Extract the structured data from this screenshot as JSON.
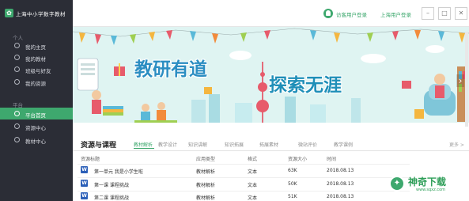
{
  "app": {
    "title": "上海中小学数字教材"
  },
  "header": {
    "guest_login": "访客用户登录",
    "shanghai_login": "上海用户登录"
  },
  "sidebar": {
    "personal_title": "个人",
    "personal_items": [
      {
        "label": "我的主页",
        "icon": "home-icon"
      },
      {
        "label": "我的教材",
        "icon": "user-icon"
      },
      {
        "label": "班级与好友",
        "icon": "friends-icon"
      },
      {
        "label": "我的资源",
        "icon": "folder-icon"
      }
    ],
    "platform_title": "平台",
    "platform_items": [
      {
        "label": "平台首页",
        "icon": "platform-home-icon",
        "active": true
      },
      {
        "label": "资源中心",
        "icon": "resource-icon"
      },
      {
        "label": "教材中心",
        "icon": "textbook-icon"
      }
    ]
  },
  "banner": {
    "left_text": "教研有道",
    "right_text": "探索无涯"
  },
  "resources": {
    "heading": "资源与课程",
    "tabs": [
      "教材解析",
      "教学设计",
      "知识讲解",
      "知识拓展",
      "拓展素材",
      "微站评价",
      "教学课例"
    ],
    "active_tab": 0,
    "more": "更多 >",
    "columns": [
      "资源标题",
      "应用类型",
      "格式",
      "资源大小",
      "时间"
    ],
    "rows": [
      [
        "第一单元 我是小学生啦",
        "教材解析",
        "文本",
        "63K",
        "2018.08.13"
      ],
      [
        "第一课 课程挑战",
        "教材解析",
        "文本",
        "50K",
        "2018.08.13"
      ],
      [
        "第二课 课程挑战",
        "教材解析",
        "文本",
        "51K",
        "2018.08.13"
      ]
    ]
  },
  "watermark": {
    "text": "神奇下载",
    "url": "www.sqxz.com"
  },
  "colors": {
    "sidebar_bg": "#2b2d36",
    "accent_green": "#3ea86e",
    "banner_blue": "#2c8ec2"
  }
}
